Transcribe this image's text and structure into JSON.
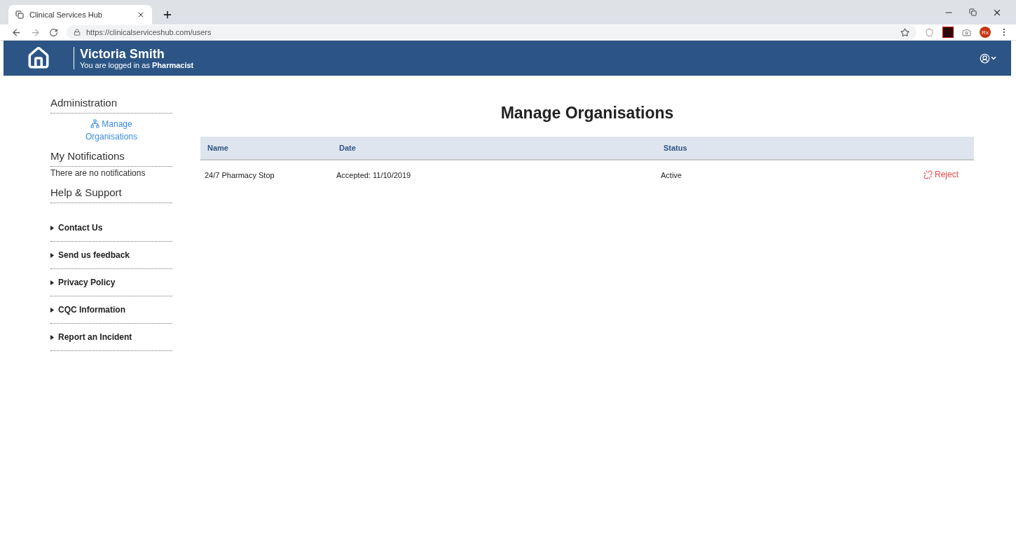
{
  "browser": {
    "tab_title": "Clinical Services Hub",
    "url": "https://clinicalserviceshub.com/users",
    "profile_badge": "Rx"
  },
  "header": {
    "user_name": "Victoria Smith",
    "login_prefix": "You are logged in as ",
    "role": "Pharmacist"
  },
  "sidebar": {
    "sections": [
      {
        "kind": "links",
        "title": "Administration",
        "items": [
          "Manage Organisations"
        ]
      },
      {
        "kind": "text",
        "title": "My Notifications",
        "text": "There are no notifications"
      },
      {
        "kind": "menu",
        "title": "Help & Support",
        "items": [
          "Contact Us",
          "Send us feedback",
          "Privacy Policy",
          "CQC Information",
          "Report an Incident"
        ]
      }
    ]
  },
  "main": {
    "title": "Manage Organisations",
    "table": {
      "columns": [
        "Name",
        "Date",
        "Status"
      ],
      "rows": [
        {
          "cells": [
            "24/7 Pharmacy Stop",
            "Accepted: 11/10/2019",
            "Active"
          ],
          "action": "Reject"
        }
      ]
    }
  }
}
